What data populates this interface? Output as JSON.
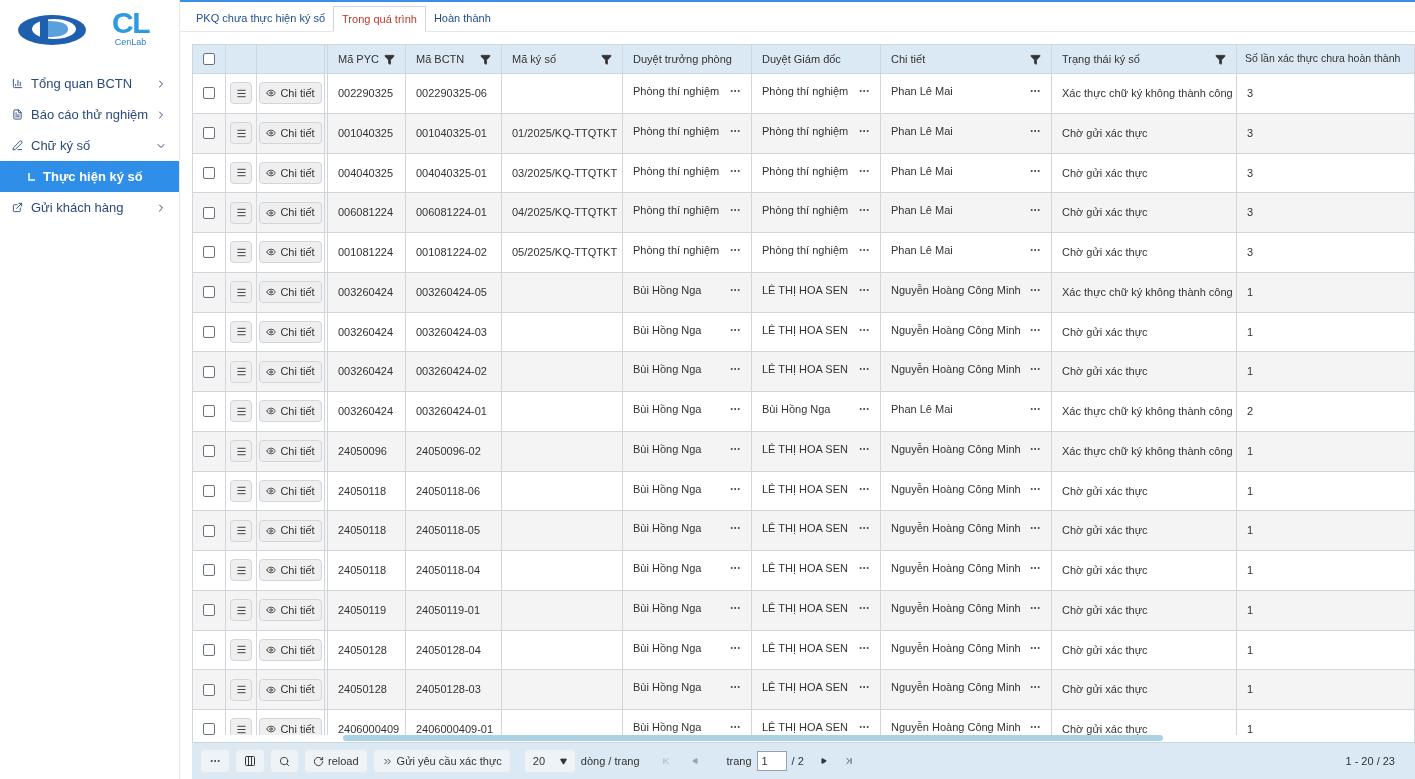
{
  "logo": {
    "mark": "CL",
    "caption": "CenLab"
  },
  "sidebar": {
    "items": [
      {
        "kind": "chart",
        "label": "Tổng quan BCTN",
        "expanded": false
      },
      {
        "kind": "doc",
        "label": "Báo cáo thử nghiệm",
        "expanded": false
      },
      {
        "kind": "sign",
        "label": "Chữ ký số",
        "expanded": true,
        "children": [
          {
            "label": "Thực hiện ký số",
            "selected": true
          }
        ]
      },
      {
        "kind": "send",
        "label": "Gửi khách hàng",
        "expanded": false
      }
    ]
  },
  "tabs": [
    {
      "label": "PKQ chưa thực hiện ký số",
      "selected": false
    },
    {
      "label": "Trong quá trình",
      "selected": true
    },
    {
      "label": "Hoàn thành",
      "selected": false
    }
  ],
  "table": {
    "all_checked": false,
    "columns": [
      {
        "label": "Mã PYC",
        "filter": true
      },
      {
        "label": "Mã BCTN",
        "filter": true
      },
      {
        "label": "Mã ký số",
        "filter": true
      },
      {
        "label": "Duyệt trưởng phòng",
        "filter": false
      },
      {
        "label": "Duyệt Giám đốc",
        "filter": false
      },
      {
        "label": "Chi tiết",
        "filter": true
      },
      {
        "label": "Trạng thái ký số",
        "filter": true
      },
      {
        "label": "Số lần xác thực chưa hoàn thành",
        "filter": false
      }
    ],
    "rows": [
      {
        "checked": false,
        "detail": "Chi tiết",
        "pyc": "002290325",
        "bctn": "002290325-06",
        "tp": "Phòng thí nghiệm",
        "gd": "Phòng thí nghiệm",
        "ct": "Phan Lê Mai",
        "tt": "Xác thực chữ ký không thành công",
        "sl": "3"
      },
      {
        "checked": false,
        "detail": "Chi tiết",
        "pyc": "001040325",
        "bctn": "001040325-01",
        "kyso": "01/2025/KQ-TTQTKT",
        "tp": "Phòng thí nghiệm",
        "gd": "Phòng thí nghiệm",
        "ct": "Phan Lê Mai",
        "tt": "Chờ gửi xác thực",
        "sl": "3"
      },
      {
        "checked": false,
        "detail": "Chi tiết",
        "pyc": "004040325",
        "bctn": "004040325-01",
        "kyso": "03/2025/KQ-TTQTKT",
        "tp": "Phòng thí nghiệm",
        "gd": "Phòng thí nghiệm",
        "ct": "Phan Lê Mai",
        "tt": "Chờ gửi xác thực",
        "sl": "3"
      },
      {
        "checked": false,
        "detail": "Chi tiết",
        "pyc": "006081224",
        "bctn": "006081224-01",
        "kyso": "04/2025/KQ-TTQTKT",
        "tp": "Phòng thí nghiệm",
        "gd": "Phòng thí nghiệm",
        "ct": "Phan Lê Mai",
        "tt": "Chờ gửi xác thực",
        "sl": "3"
      },
      {
        "checked": false,
        "detail": "Chi tiết",
        "pyc": "001081224",
        "bctn": "001081224-02",
        "kyso": "05/2025/KQ-TTQTKT",
        "tp": "Phòng thí nghiệm",
        "gd": "Phòng thí nghiệm",
        "ct": "Phan Lê Mai",
        "tt": "Chờ gửi xác thực",
        "sl": "3"
      },
      {
        "checked": false,
        "detail": "Chi tiết",
        "pyc": "003260424",
        "bctn": "003260424-05",
        "tp": "Bùi Hồng Nga",
        "gd": "LÊ THỊ HOA SEN",
        "ct": "Nguyễn Hoàng Công Minh",
        "tt": "Xác thực chữ ký không thành công",
        "sl": "1"
      },
      {
        "checked": false,
        "detail": "Chi tiết",
        "pyc": "003260424",
        "bctn": "003260424-03",
        "tp": "Bùi Hồng Nga",
        "gd": "LÊ THỊ HOA SEN",
        "ct": "Nguyễn Hoàng Công Minh",
        "tt": "Chờ gửi xác thực",
        "sl": "1"
      },
      {
        "checked": false,
        "detail": "Chi tiết",
        "pyc": "003260424",
        "bctn": "003260424-02",
        "tp": "Bùi Hồng Nga",
        "gd": "LÊ THỊ HOA SEN",
        "ct": "Nguyễn Hoàng Công Minh",
        "tt": "Chờ gửi xác thực",
        "sl": "1"
      },
      {
        "checked": false,
        "detail": "Chi tiết",
        "pyc": "003260424",
        "bctn": "003260424-01",
        "tp": "Bùi Hồng Nga",
        "gd": "Bùi Hồng Nga",
        "ct": "Phan Lê Mai",
        "tt": "Xác thực chữ ký không thành công",
        "sl": "2"
      },
      {
        "checked": false,
        "detail": "Chi tiết",
        "pyc": "24050096",
        "bctn": "24050096-02",
        "tp": "Bùi Hồng Nga",
        "gd": "LÊ THỊ HOA SEN",
        "ct": "Nguyễn Hoàng Công Minh",
        "tt": "Xác thực chữ ký không thành công",
        "sl": "1"
      },
      {
        "checked": false,
        "detail": "Chi tiết",
        "pyc": "24050118",
        "bctn": "24050118-06",
        "tp": "Bùi Hồng Nga",
        "gd": "LÊ THỊ HOA SEN",
        "ct": "Nguyễn Hoàng Công Minh",
        "tt": "Chờ gửi xác thực",
        "sl": "1"
      },
      {
        "checked": false,
        "detail": "Chi tiết",
        "pyc": "24050118",
        "bctn": "24050118-05",
        "tp": "Bùi Hồng Nga",
        "gd": "LÊ THỊ HOA SEN",
        "ct": "Nguyễn Hoàng Công Minh",
        "tt": "Chờ gửi xác thực",
        "sl": "1"
      },
      {
        "checked": false,
        "detail": "Chi tiết",
        "pyc": "24050118",
        "bctn": "24050118-04",
        "tp": "Bùi Hồng Nga",
        "gd": "LÊ THỊ HOA SEN",
        "ct": "Nguyễn Hoàng Công Minh",
        "tt": "Chờ gửi xác thực",
        "sl": "1"
      },
      {
        "checked": false,
        "detail": "Chi tiết",
        "pyc": "24050119",
        "bctn": "24050119-01",
        "tp": "Bùi Hồng Nga",
        "gd": "LÊ THỊ HOA SEN",
        "ct": "Nguyễn Hoàng Công Minh",
        "tt": "Chờ gửi xác thực",
        "sl": "1"
      },
      {
        "checked": false,
        "detail": "Chi tiết",
        "pyc": "24050128",
        "bctn": "24050128-04",
        "tp": "Bùi Hồng Nga",
        "gd": "LÊ THỊ HOA SEN",
        "ct": "Nguyễn Hoàng Công Minh",
        "tt": "Chờ gửi xác thực",
        "sl": "1"
      },
      {
        "checked": false,
        "detail": "Chi tiết",
        "pyc": "24050128",
        "bctn": "24050128-03",
        "tp": "Bùi Hồng Nga",
        "gd": "LÊ THỊ HOA SEN",
        "ct": "Nguyễn Hoàng Công Minh",
        "tt": "Chờ gửi xác thực",
        "sl": "1"
      },
      {
        "checked": false,
        "detail": "Chi tiết",
        "pyc": "2406000409",
        "bctn": "2406000409-01",
        "tp": "Bùi Hồng Nga",
        "gd": "LÊ THỊ HOA SEN",
        "ct": "Nguyễn Hoàng Công Minh",
        "tt": "Chờ gửi xác thực",
        "sl": "1"
      }
    ]
  },
  "footer": {
    "reload": "reload",
    "send": "Gửi yêu cầu xác thực",
    "page_size": "20",
    "per_page": "dòng / trang",
    "page_label": "trang",
    "page": "1",
    "page_total": "/ 2",
    "range": "1 - 20 / 23"
  }
}
